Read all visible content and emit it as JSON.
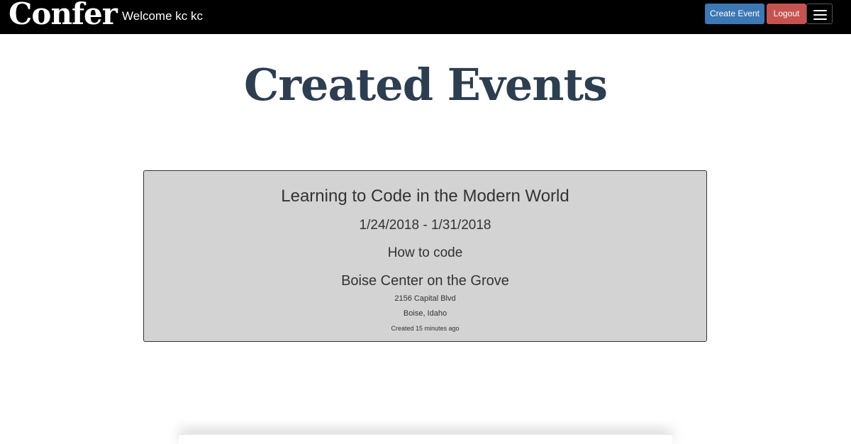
{
  "navbar": {
    "brand": "Confer",
    "welcome": "Welcome kc kc",
    "create_event_label": "Create Event",
    "logout_label": "Logout",
    "menu_icon": "hamburger-icon"
  },
  "page": {
    "title": "Created Events"
  },
  "events": [
    {
      "title": "Learning to Code in the Modern World",
      "dates": "1/24/2018 - 1/31/2018",
      "description": "How to code",
      "venue": "Boise Center on the Grove",
      "address": "2156 Capital Blvd",
      "city_state": "Boise, Idaho",
      "created": "Created 15 minutes ago"
    }
  ],
  "colors": {
    "navbar_bg": "#000000",
    "create_button": "#3c78b4",
    "logout_button": "#c65350",
    "title": "#2c3e50",
    "card_bg": "#d3d3d3"
  }
}
